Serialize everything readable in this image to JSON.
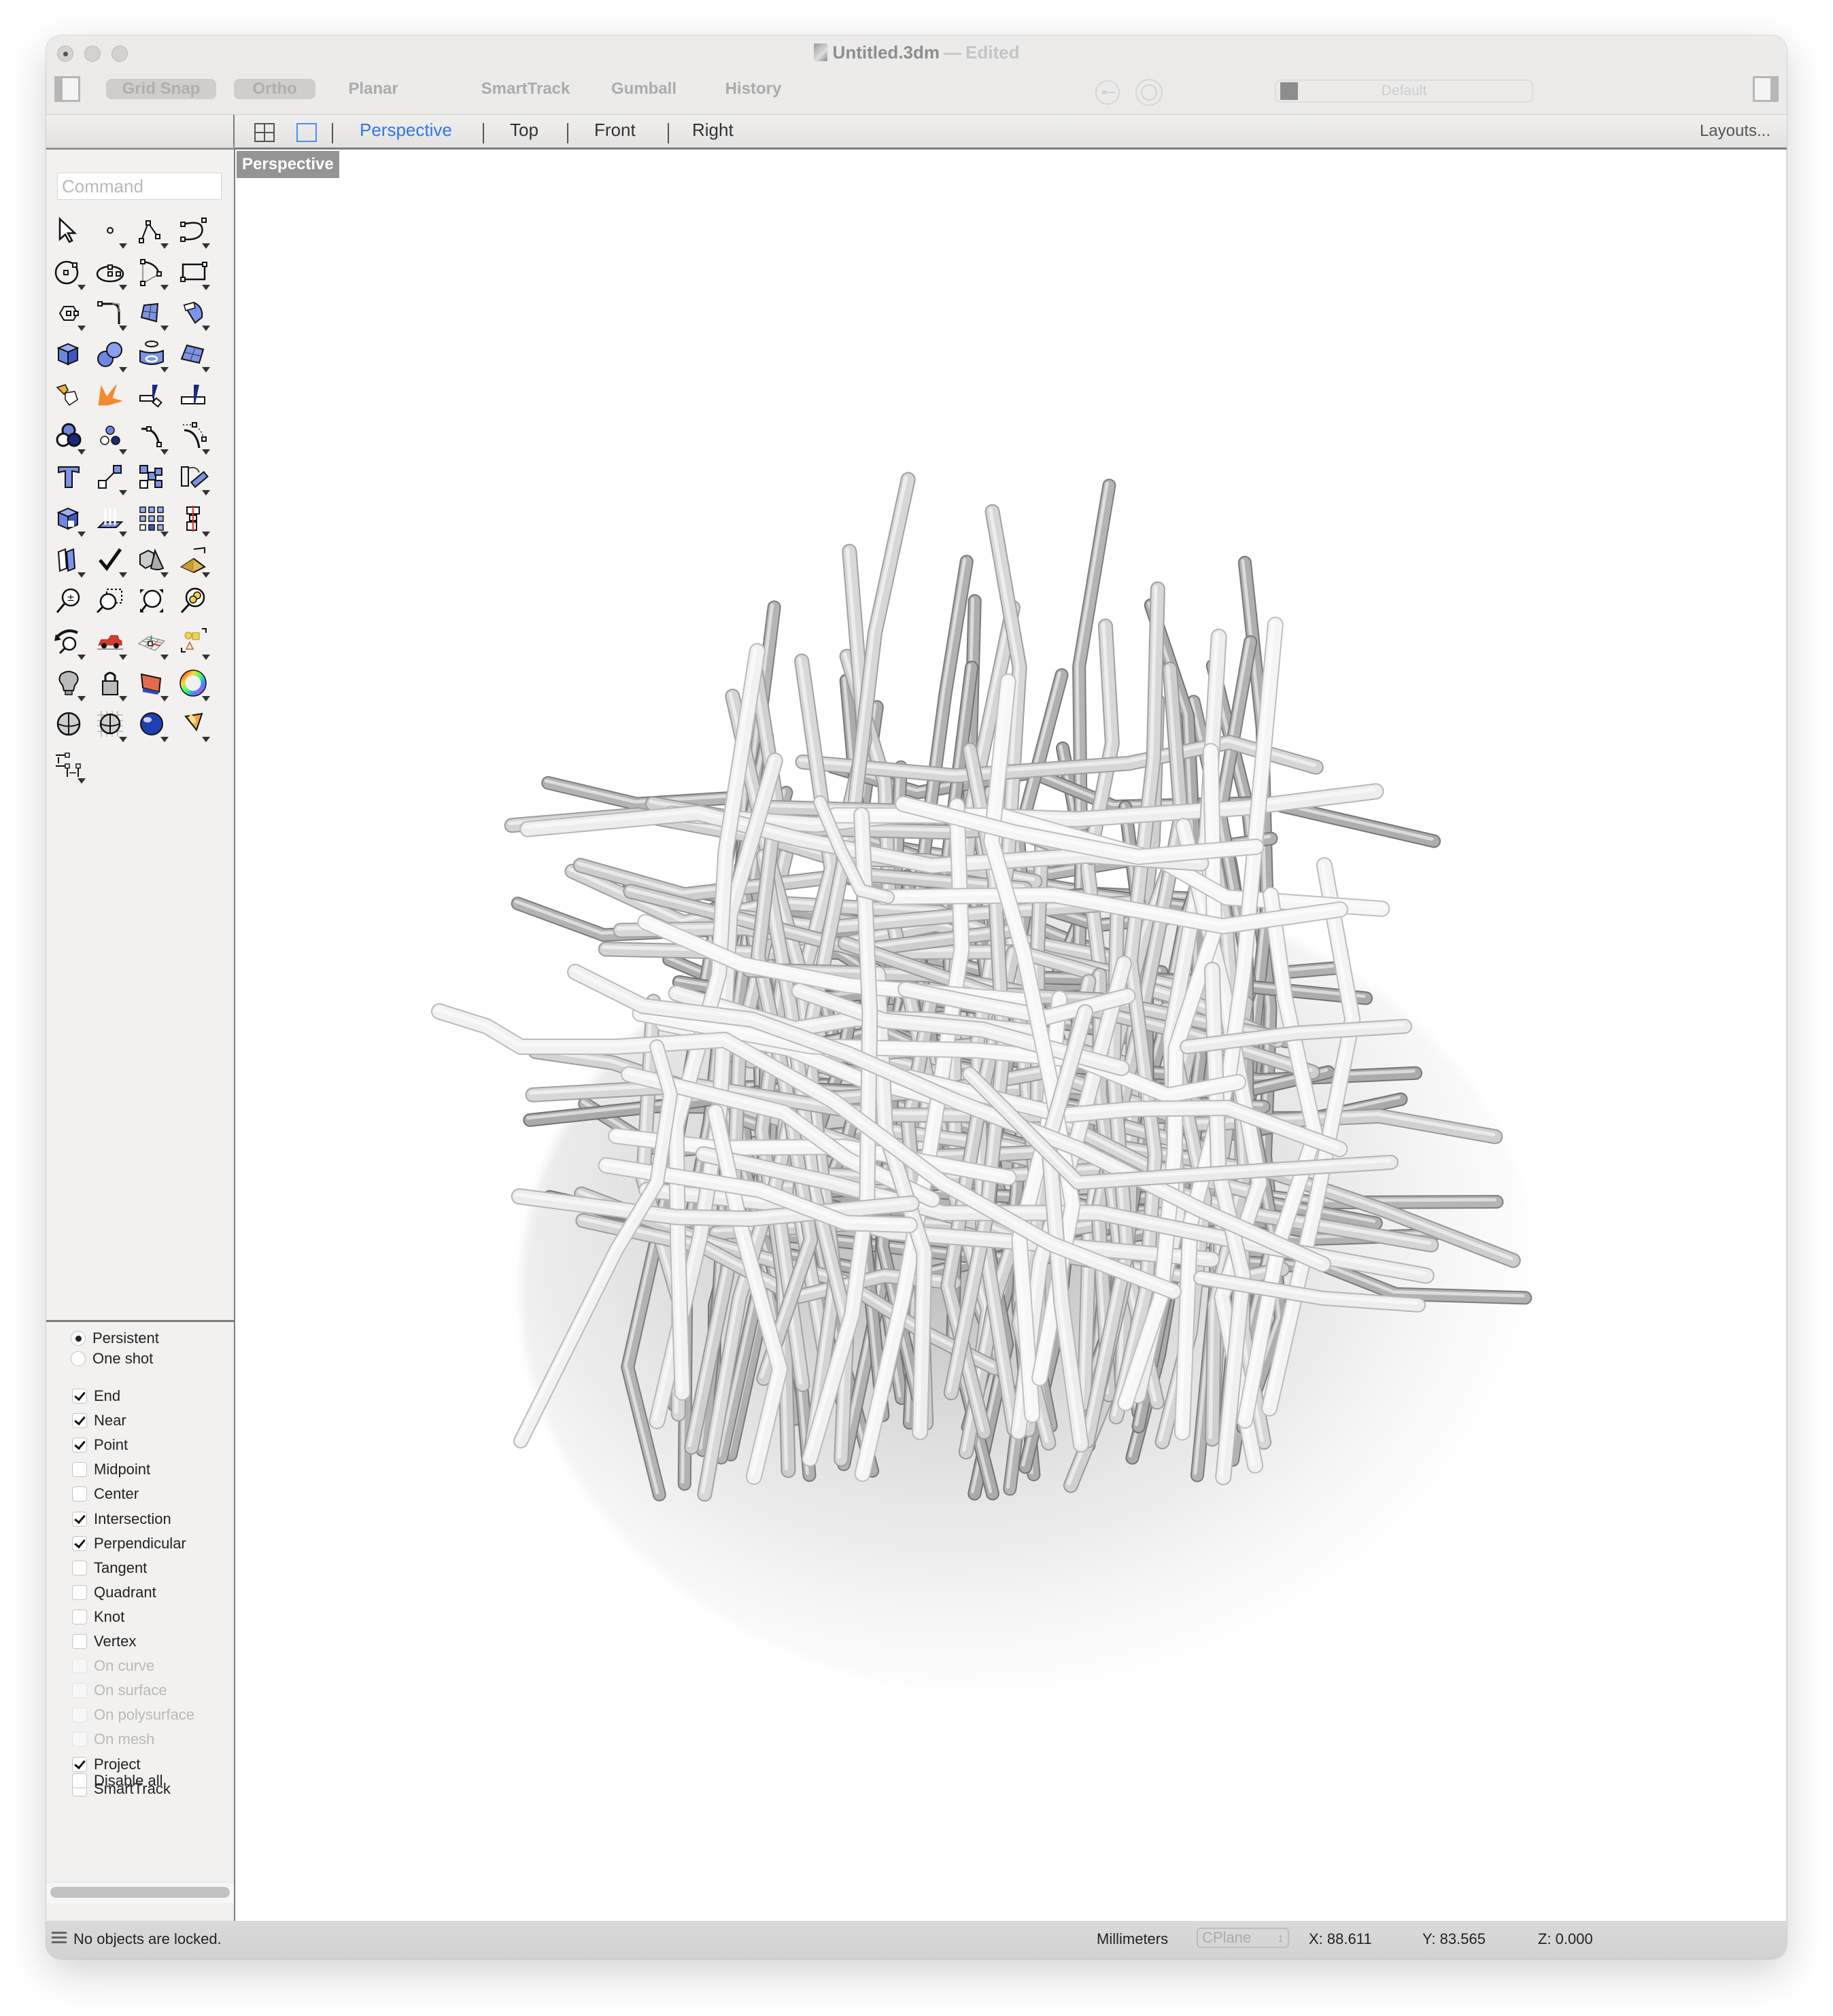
{
  "window": {
    "title": "Untitled.3dm",
    "title_separator": "—",
    "title_status": "Edited"
  },
  "toolbar": {
    "buttons": [
      {
        "label": "Grid Snap",
        "active": true
      },
      {
        "label": "Ortho",
        "active": true
      },
      {
        "label": "Planar",
        "active": false
      },
      {
        "label": "SmartTrack",
        "active": false
      },
      {
        "label": "Gumball",
        "active": false
      },
      {
        "label": "History",
        "active": false
      }
    ],
    "layer": {
      "name": "Default",
      "swatch_color": "#8d8d8d"
    }
  },
  "viewport_tabs": {
    "tabs": [
      {
        "label": "Perspective",
        "active": true
      },
      {
        "label": "Top",
        "active": false
      },
      {
        "label": "Front",
        "active": false
      },
      {
        "label": "Right",
        "active": false
      }
    ],
    "layouts_label": "Layouts...",
    "active_color": "#2d77e6"
  },
  "command": {
    "placeholder": "Command",
    "value": ""
  },
  "tool_palette": [
    [
      "select-arrow",
      "point",
      "polyline",
      "curve"
    ],
    [
      "circle",
      "ellipse",
      "arc",
      "rectangle"
    ],
    [
      "polygon",
      "fillet-curve",
      "surface-from-points",
      "extrude-surface"
    ],
    [
      "box",
      "sphere-union",
      "cylinder-pipe",
      "surface-network"
    ],
    [
      "join-puzzle",
      "explode",
      "trim",
      "split"
    ],
    [
      "boolean-union",
      "boolean-split",
      "curve-offset",
      "curve-extend"
    ],
    [
      "text",
      "move",
      "array",
      "rotate"
    ],
    [
      "solid-edit",
      "extrude-normals",
      "array-grid",
      "mirror"
    ],
    [
      "analyze-draft",
      "check",
      "primitives",
      "cage-edit"
    ],
    [
      "zoom-in-out",
      "zoom-window",
      "zoom-extents",
      "zoom-selected"
    ],
    [
      "rotate-view",
      "render-car",
      "cplane",
      "layout-shapes"
    ],
    [
      "lights",
      "lock",
      "materials",
      "color-wheel"
    ],
    [
      "shaded-sphere",
      "grid-sphere",
      "rendered-sphere",
      "spotlight"
    ],
    [
      "dimension"
    ]
  ],
  "osnap": {
    "modes": [
      {
        "label": "Persistent",
        "selected": true
      },
      {
        "label": "One shot",
        "selected": false
      }
    ],
    "snaps": [
      {
        "label": "End",
        "checked": true,
        "enabled": true
      },
      {
        "label": "Near",
        "checked": true,
        "enabled": true
      },
      {
        "label": "Point",
        "checked": true,
        "enabled": true
      },
      {
        "label": "Midpoint",
        "checked": false,
        "enabled": true
      },
      {
        "label": "Center",
        "checked": false,
        "enabled": true
      },
      {
        "label": "Intersection",
        "checked": true,
        "enabled": true
      },
      {
        "label": "Perpendicular",
        "checked": true,
        "enabled": true
      },
      {
        "label": "Tangent",
        "checked": false,
        "enabled": true
      },
      {
        "label": "Quadrant",
        "checked": false,
        "enabled": true
      },
      {
        "label": "Knot",
        "checked": false,
        "enabled": true
      },
      {
        "label": "Vertex",
        "checked": false,
        "enabled": true
      },
      {
        "label": "On curve",
        "checked": false,
        "enabled": false
      },
      {
        "label": "On surface",
        "checked": false,
        "enabled": false
      },
      {
        "label": "On polysurface",
        "checked": false,
        "enabled": false
      },
      {
        "label": "On mesh",
        "checked": false,
        "enabled": false
      },
      {
        "label": "Project",
        "checked": true,
        "enabled": true
      },
      {
        "label": "SmartTrack",
        "checked": false,
        "enabled": true
      }
    ],
    "disable_all": {
      "label": "Disable all",
      "checked": false
    }
  },
  "viewport": {
    "label": "Perspective",
    "content": "rendered branching tube structure"
  },
  "statusbar": {
    "message": "No objects are locked.",
    "units": "Millimeters",
    "cplane": "CPlane",
    "x": "X: 88.611",
    "y": "Y: 83.565",
    "z": "Z: 0.000"
  }
}
